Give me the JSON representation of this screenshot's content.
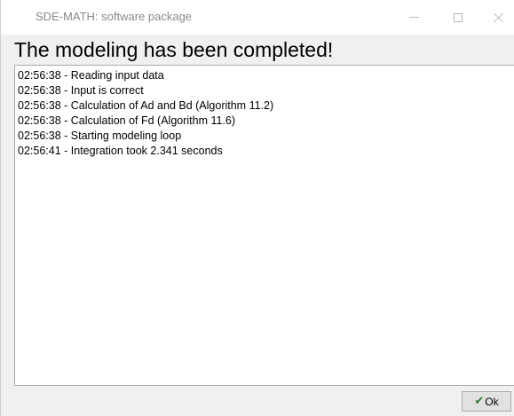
{
  "window": {
    "title": "SDE-MATH: software package"
  },
  "heading": "The modeling has been completed!",
  "log": [
    "02:56:38 - Reading input data",
    "02:56:38 - Input is correct",
    "02:56:38 - Calculation of Ad and Bd (Algorithm 11.2)",
    "02:56:38 - Calculation of Fd (Algorithm 11.6)",
    "02:56:38 - Starting modeling loop",
    "02:56:41 - Integration took 2.341 seconds"
  ],
  "buttons": {
    "ok_label": "Ok",
    "ok_icon": "check-icon"
  },
  "colors": {
    "check": "#2e7d32",
    "background": "#f0f0f0"
  }
}
